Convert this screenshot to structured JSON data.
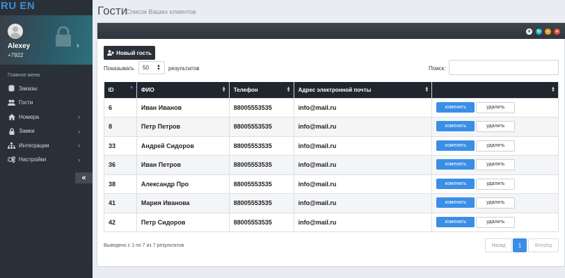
{
  "lang": "RU EN",
  "profile": {
    "name": "Alexey",
    "phone": "+7922"
  },
  "menu_title": "Главное меню",
  "menu": [
    {
      "label": "Заказы",
      "icon": "database-icon",
      "chevron": false
    },
    {
      "label": "Гости",
      "icon": "users-icon",
      "chevron": false
    },
    {
      "label": "Номера",
      "icon": "home-icon",
      "chevron": true
    },
    {
      "label": "Замки",
      "icon": "lock-icon",
      "chevron": true
    },
    {
      "label": "Интеграции",
      "icon": "sitemap-icon",
      "chevron": true
    },
    {
      "label": "Настройки",
      "icon": "cogs-icon",
      "chevron": true
    }
  ],
  "collapse_label": "«",
  "page": {
    "title": "Гости",
    "subtitle": "Список Ваших клиентов"
  },
  "toolbar": {
    "new_guest": "Новый гость",
    "show_label": "Показывать",
    "show_value": "50",
    "results_label": "результатов",
    "search_label": "Поиск:",
    "search_value": ""
  },
  "table": {
    "headers": [
      "ID",
      "ФИО",
      "Телефон",
      "Адрес электронной почты",
      ""
    ],
    "rows": [
      {
        "id": "6",
        "name": "Иван Иванов",
        "phone": "88005553535",
        "email": "info@mail.ru"
      },
      {
        "id": "8",
        "name": "Петр Петров",
        "phone": "88005553535",
        "email": "info@mail.ru"
      },
      {
        "id": "33",
        "name": "Андрей Сидоров",
        "phone": "88005553535",
        "email": "info@mail.ru"
      },
      {
        "id": "36",
        "name": "Иван Петров",
        "phone": "88005553535",
        "email": "info@mail.ru"
      },
      {
        "id": "38",
        "name": "Александр Про",
        "phone": "88005553535",
        "email": "info@mail.ru"
      },
      {
        "id": "41",
        "name": "Мария Иванова",
        "phone": "88005553535",
        "email": "info@mail.ru"
      },
      {
        "id": "42",
        "name": "Петр Сидоров",
        "phone": "88005553535",
        "email": "info@mail.ru"
      }
    ],
    "edit_label": "изменить",
    "delete_label": "удалить"
  },
  "footer": {
    "info": "Выведено с 1 по 7 из 7 результатов",
    "prev": "Назад",
    "page": "1",
    "next": "Вперёд"
  },
  "colors": {
    "accent": "#3a8ee6",
    "sidebar": "#2a3038",
    "header": "#1f262d",
    "lang": "#3a8fd6"
  }
}
